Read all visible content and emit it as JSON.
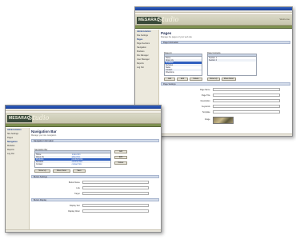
{
  "back_window": {
    "logo": "MESARAC",
    "logo_script": "Studio",
    "header_right": "Welcome",
    "page_title": "Pages",
    "page_subtitle": "Manage the pages of your web site",
    "section_title": "Page Information",
    "sidebar": [
      "Administration",
      "Site Settings",
      "Pages",
      "Page Sections",
      "Navigation",
      "Modules",
      "File Manager",
      "User Manager",
      "Reports",
      "Log Out"
    ],
    "left_list_label": "Pages In",
    "right_list_label": "Page Contents",
    "left_rows": [
      "Home",
      "About Us",
      "Products",
      "Services",
      "News",
      "Contact",
      "Directions"
    ],
    "right_rows": [
      "Section 1",
      "Section 2"
    ],
    "buttons": [
      "Add",
      "Edit",
      "Delete",
      "Move Up",
      "Move Down"
    ],
    "settings_label": "Page Settings",
    "fields": [
      "Page Name",
      "Page Title",
      "Description",
      "Keywords",
      "Template",
      "Image"
    ]
  },
  "front_window": {
    "logo": "MESARAC",
    "logo_script": "Studio",
    "page_title": "Navigation Bar",
    "page_subtitle": "Manage your site navigation",
    "section_title": "Navigation Information",
    "sidebar": [
      "Administration",
      "Site Settings",
      "Pages",
      "Navigation",
      "Modules",
      "Reports",
      "Log Out"
    ],
    "list_label": "Navigation Bar",
    "rows": [
      "Home",
      "About Us",
      "Products",
      "Services",
      "Contact"
    ],
    "row_links": [
      "index.htm",
      "about.htm",
      "products.htm",
      "services.htm",
      "contact.htm"
    ],
    "side_buttons": [
      "Add",
      "Edit",
      "Delete"
    ],
    "bottom_buttons": [
      "Move Up",
      "Move Down",
      "Save"
    ],
    "settings_label": "Button Settings",
    "fields": [
      "Button Name",
      "Link",
      "Target"
    ],
    "display_label": "Button Display",
    "display_fields": [
      "Display Text",
      "Display Order"
    ]
  }
}
